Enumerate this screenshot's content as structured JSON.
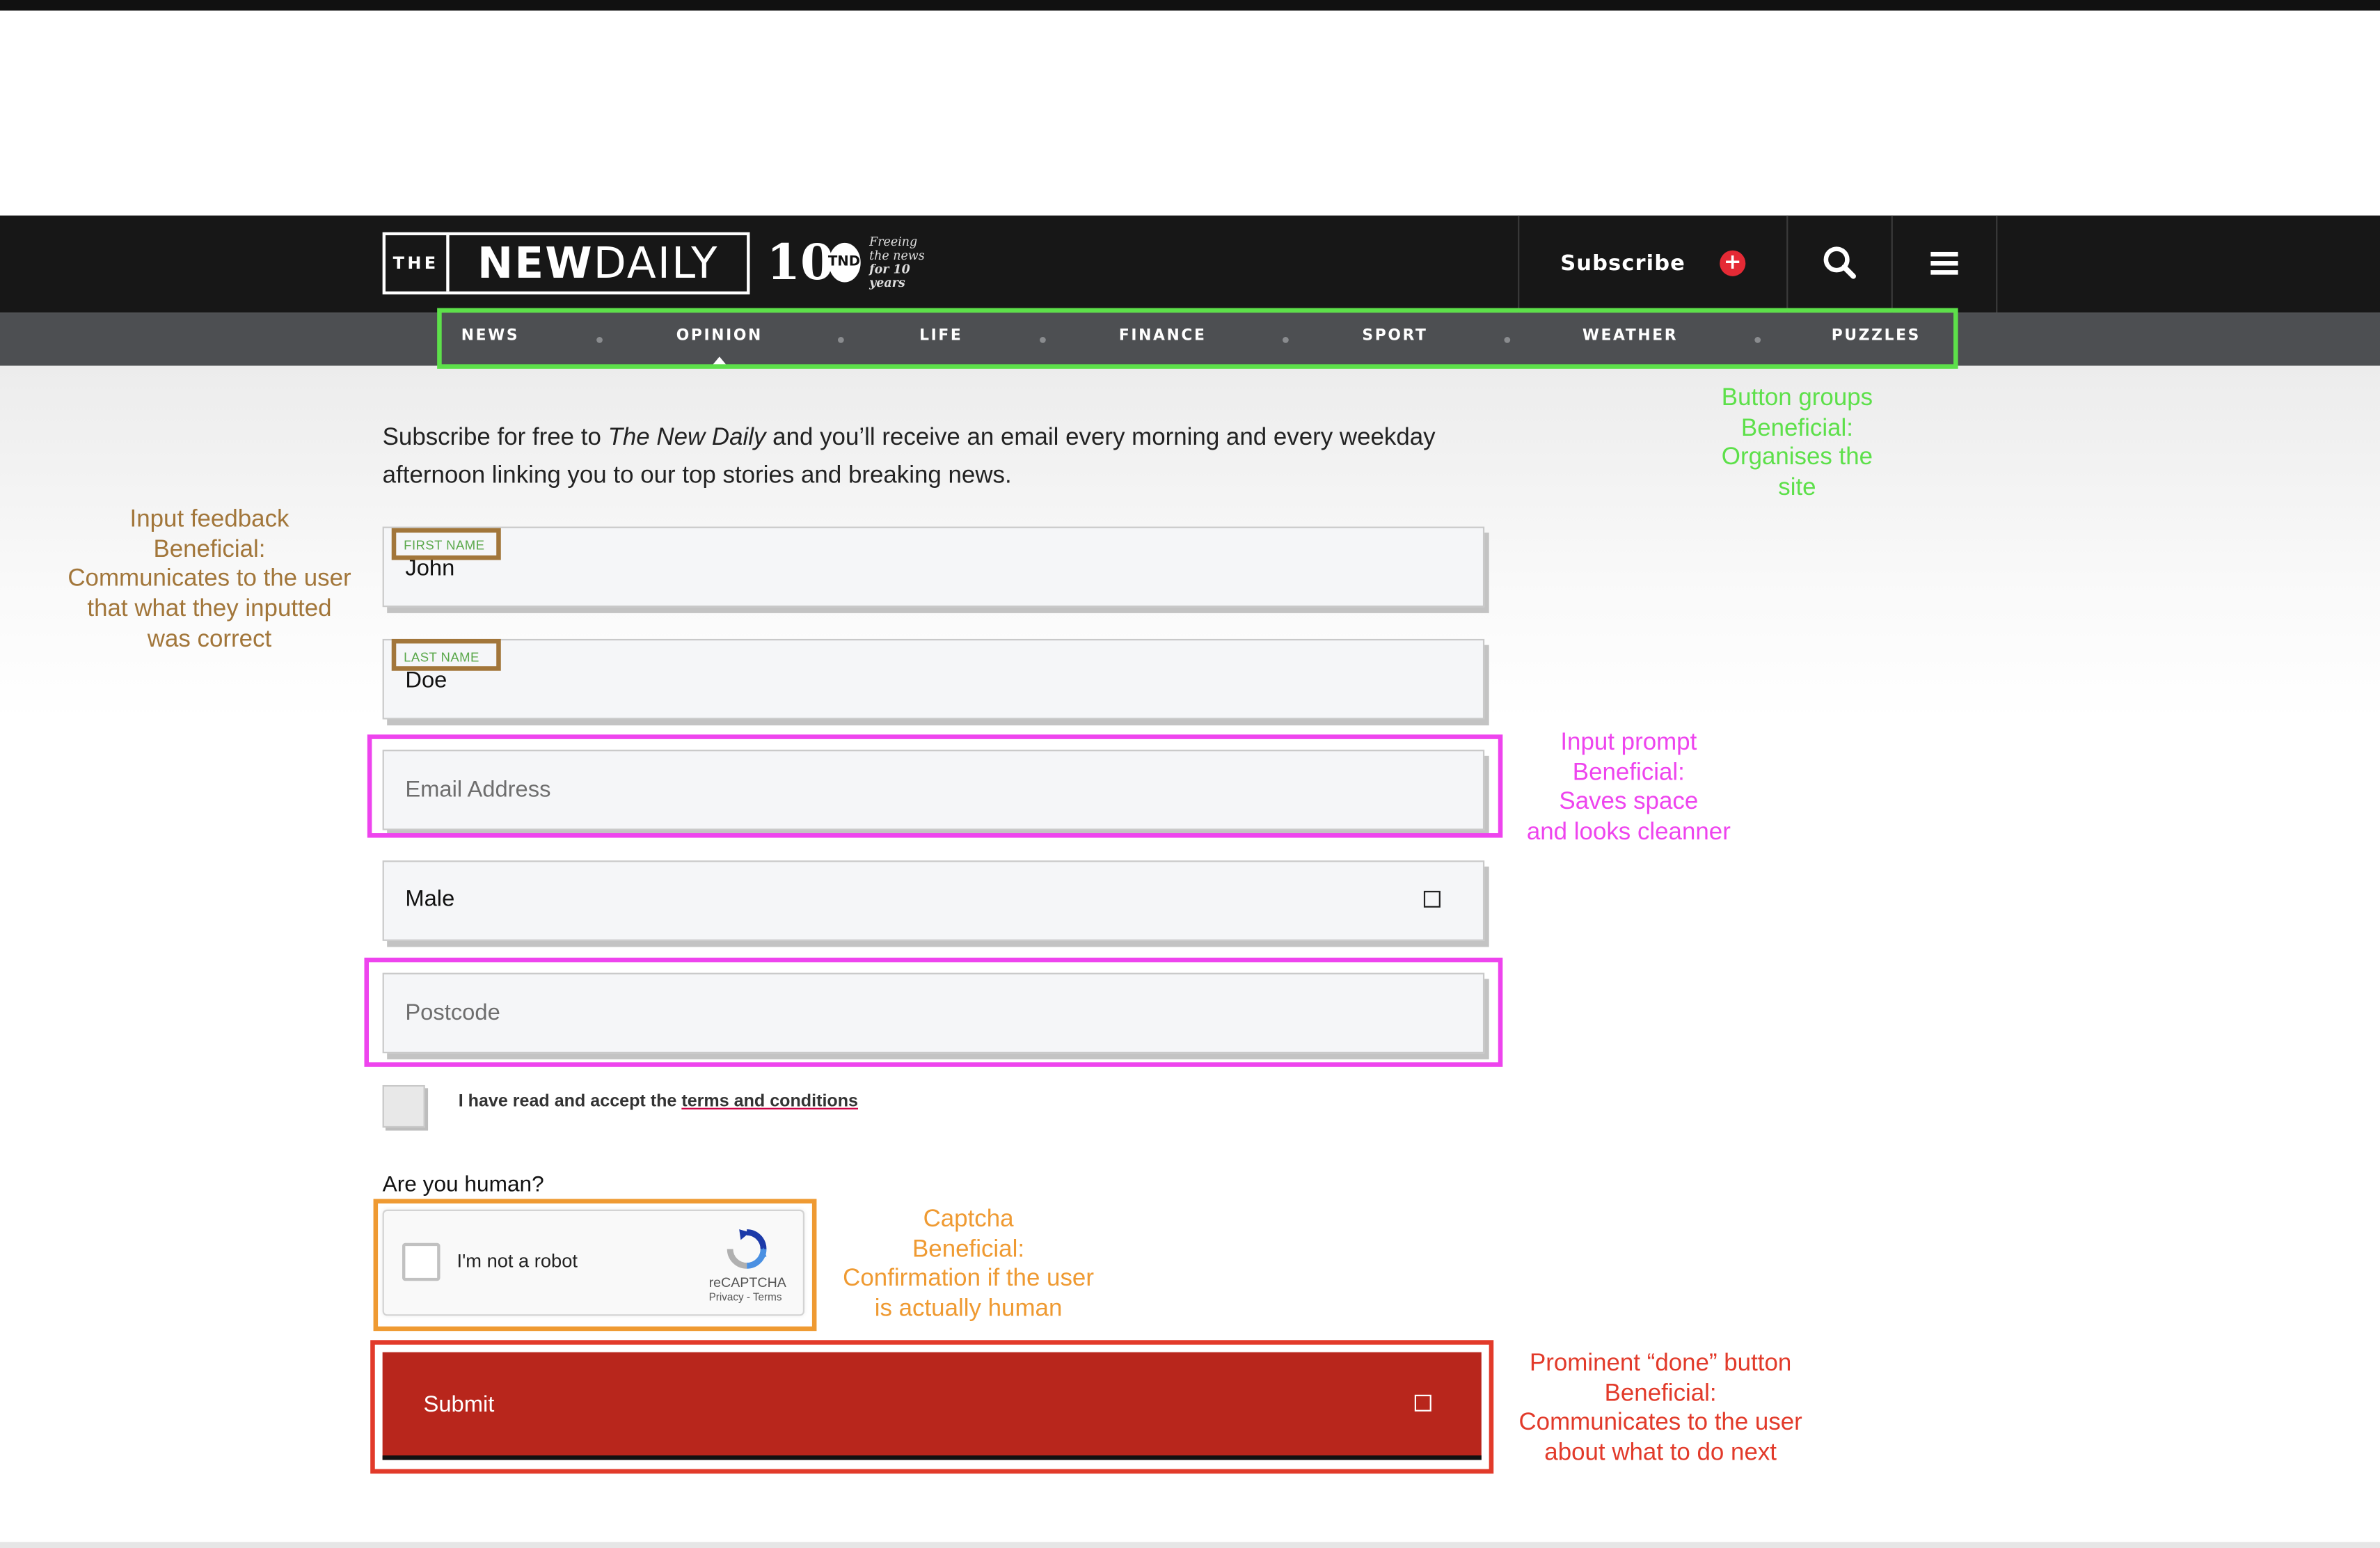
{
  "header": {
    "logo_the": "THE",
    "logo_new": "NEW",
    "logo_daily": "DAILY",
    "badge_number": "10",
    "badge_circle": "TND",
    "badge_tagline_1": "Freeing the news",
    "badge_tagline_2": "for 10 years",
    "subscribe_label": "Subscribe",
    "subscribe_icon": "plus-circle-icon",
    "search_icon": "search-icon",
    "menu_icon": "hamburger-menu-icon"
  },
  "nav": {
    "items": [
      "NEWS",
      "OPINION",
      "LIFE",
      "FINANCE",
      "SPORT",
      "WEATHER",
      "PUZZLES"
    ],
    "active": "OPINION"
  },
  "intro": {
    "text_before": "Subscribe for free to ",
    "publication": "The New Daily",
    "text_after": " and you’ll receive an email every morning and every weekday afternoon linking you to our top stories and breaking news."
  },
  "form": {
    "first_name": {
      "label": "FIRST NAME",
      "value": "John"
    },
    "last_name": {
      "label": "LAST NAME",
      "value": "Doe"
    },
    "email": {
      "placeholder": "Email Address"
    },
    "gender": {
      "value": "Male"
    },
    "postcode": {
      "placeholder": "Postcode"
    },
    "terms_text": "I have read and accept the ",
    "terms_link": "terms and conditions",
    "human_question": "Are you human?",
    "captcha": {
      "label": "I'm not a robot",
      "brand": "reCAPTCHA",
      "links": "Privacy - Terms"
    },
    "submit_label": "Submit"
  },
  "annotations": {
    "colors": {
      "green": "#5de04a",
      "brown": "#a2763a",
      "magenta": "#ee44ee",
      "orange": "#ef9a32",
      "red": "#e23a2a"
    },
    "button_groups": [
      "Button groups",
      "Beneficial:",
      "Organises the",
      "site"
    ],
    "input_feedback": [
      "Input feedback",
      "Beneficial:",
      "Communicates to the user",
      "that what they inputted",
      "was correct"
    ],
    "input_prompt": [
      "Input prompt",
      "Beneficial:",
      "Saves space",
      "and looks cleanner"
    ],
    "captcha": [
      "Captcha",
      "Beneficial:",
      "Confirmation if the user",
      "is actually human"
    ],
    "done_button": [
      "Prominent “done” button",
      "Beneficial:",
      "Communicates to the user",
      "about what to do next"
    ]
  }
}
